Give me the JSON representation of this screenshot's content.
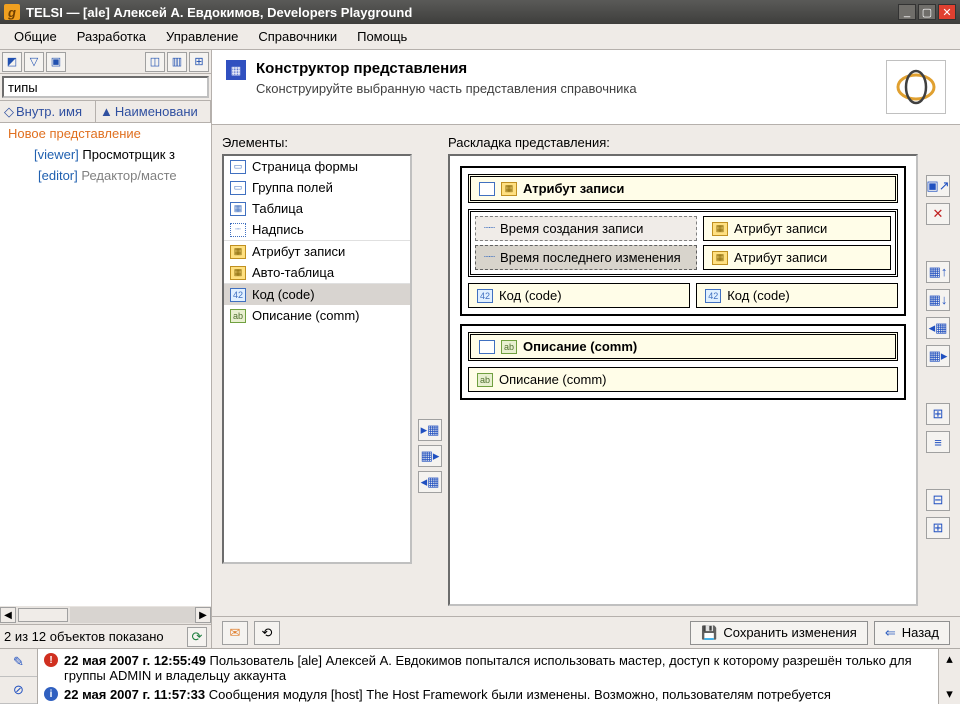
{
  "window": {
    "title": "TELSI — [ale] Алексей А. Евдокимов, Developers Playground"
  },
  "menu": {
    "items": [
      "Общие",
      "Разработка",
      "Управление",
      "Справочники",
      "Помощь"
    ]
  },
  "left": {
    "search_value": "типы",
    "col1": "Внутр. имя",
    "col2": "Наименовани",
    "rows": {
      "new": "Новое представление",
      "viewer_prefix": "[viewer]",
      "viewer_label": "Просмотрщик з",
      "editor_prefix": "[editor]",
      "editor_label": "Редактор/масте"
    },
    "status": "2 из 12 объектов показано"
  },
  "header": {
    "title": "Конструктор представления",
    "desc": "Сконструируйте выбранную часть представления справочника"
  },
  "designer": {
    "elem_label": "Элементы:",
    "layout_label": "Раскладка представления:",
    "elements": {
      "page": "Страница формы",
      "group": "Группа полей",
      "table": "Таблица",
      "label": "Надпись",
      "attr": "Атрибут записи",
      "autotable": "Авто-таблица",
      "code": "Код (code)",
      "comm": "Описание (comm)"
    },
    "layout": {
      "attr_header": "Атрибут записи",
      "created": "Время создания записи",
      "attr1": "Атрибут записи",
      "modified": "Время последнего изменения",
      "attr2": "Атрибут записи",
      "code1": "Код (code)",
      "code2": "Код (code)",
      "comm_header": "Описание (comm)",
      "comm1": "Описание (comm)"
    }
  },
  "footer": {
    "save": "Сохранить изменения",
    "back": "Назад"
  },
  "log": {
    "r1_time": "22 мая 2007 г. 12:55:49",
    "r1_msg": "Пользователь [ale] Алексей А. Евдокимов попытался использовать мастер, доступ к которому разрешён только для группы ADMIN и владельцу аккаунта",
    "r2_time": "22 мая 2007 г. 11:57:33",
    "r2_msg": "Сообщения модуля [host] The Host Framework были изменены. Возможно, пользователям потребуется"
  }
}
